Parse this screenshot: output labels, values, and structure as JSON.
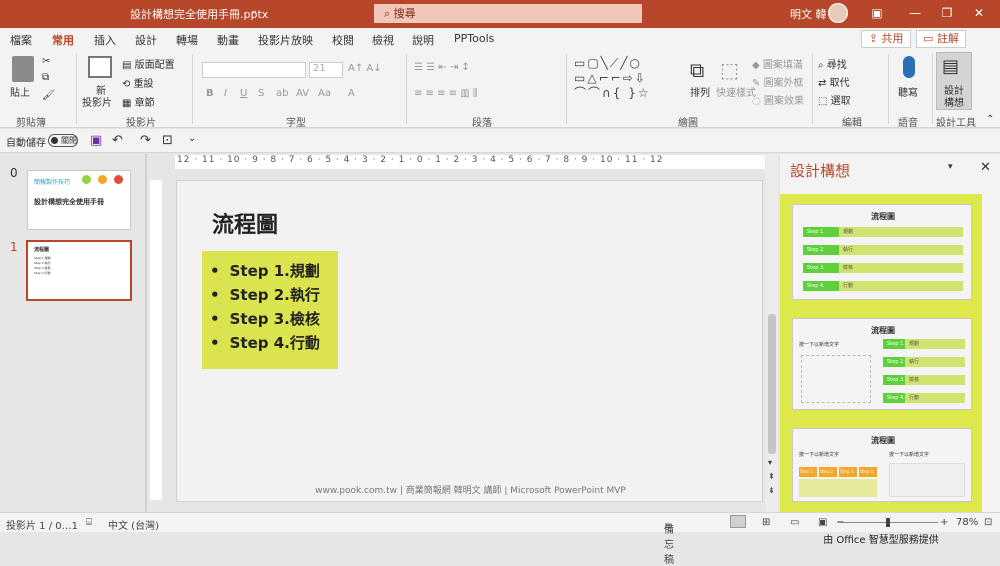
{
  "title": {
    "doc": "設計構想完全使用手冊.pptx",
    "search": "搜尋",
    "user": "明文 韓"
  },
  "tabs": [
    "檔案",
    "常用",
    "插入",
    "設計",
    "轉場",
    "動畫",
    "投影片放映",
    "校閱",
    "檢視",
    "說明",
    "PPTools"
  ],
  "share": "共用",
  "comment": "註解",
  "ribbon": {
    "paste": "貼上",
    "clipboard": "剪貼簿",
    "new_slide": "新",
    "new_slide2": "投影片",
    "layout": "版面配置",
    "reset": "重設",
    "section": "章節",
    "slides": "投影片",
    "font_size": "21",
    "font": "字型",
    "paragraph": "段落",
    "drawing": "繪圖",
    "arrange": "排列",
    "quick_styles": "快速樣式",
    "fill": "圖案填滿",
    "outline": "圖案外框",
    "effects": "圖案效果",
    "find": "尋找",
    "replace": "取代",
    "select": "選取",
    "editing": "編輯",
    "dictate": "聽寫",
    "voice": "語音",
    "designer": "設計",
    "designer2": "構想",
    "design_tools": "設計工具"
  },
  "qat": {
    "autosave": "自動儲存",
    "toggle": "關閉"
  },
  "slides": [
    {
      "num": "0",
      "brand": "簡報製作技巧",
      "title": "設計構想完全使用手冊"
    },
    {
      "num": "1",
      "title": "流程圖"
    }
  ],
  "slide": {
    "title": "流程圖",
    "bullets": [
      "Step 1.規劃",
      "Step 2.執行",
      "Step 3.檢核",
      "Step 4.行動"
    ],
    "footer": "www.pook.com.tw | 商業簡報網 韓明文 講師 | Microsoft PowerPoint MVP"
  },
  "ruler": "12 · 11 · 10 · 9 · 8 · 7 · 6 · 5 · 4 · 3 · 2 · 1 · 0 · 1 · 2 · 3 · 4 · 5 · 6 · 7 · 8 · 9 · 10 · 11 · 12",
  "design_pane": {
    "heading": "設計構想",
    "cards": [
      {
        "title": "流程圖",
        "steps": [
          "Step 1.",
          "Step 2.",
          "Step 3.",
          "Step 4."
        ],
        "labels": [
          "規劃",
          "執行",
          "檢核",
          "行動"
        ]
      },
      {
        "title": "流程圖",
        "subtitle": "按一下以新增文字",
        "steps": [
          "Step 1.",
          "Step 2.",
          "Step 3.",
          "Step 4."
        ],
        "labels": [
          "規劃",
          "執行",
          "檢核",
          "行動"
        ]
      },
      {
        "title": "流程圖",
        "subtitle": "按一下以新增文字",
        "steps": [
          "Step 1.",
          "Step 2.",
          "Step 3.",
          "Step 4."
        ]
      }
    ],
    "footer": "由 Office 智慧型服務提供"
  },
  "status": {
    "slide": "投影片 1 / 0…1",
    "lang": "中文 (台灣)",
    "notes": "備忘稿",
    "zoom": "78%"
  }
}
